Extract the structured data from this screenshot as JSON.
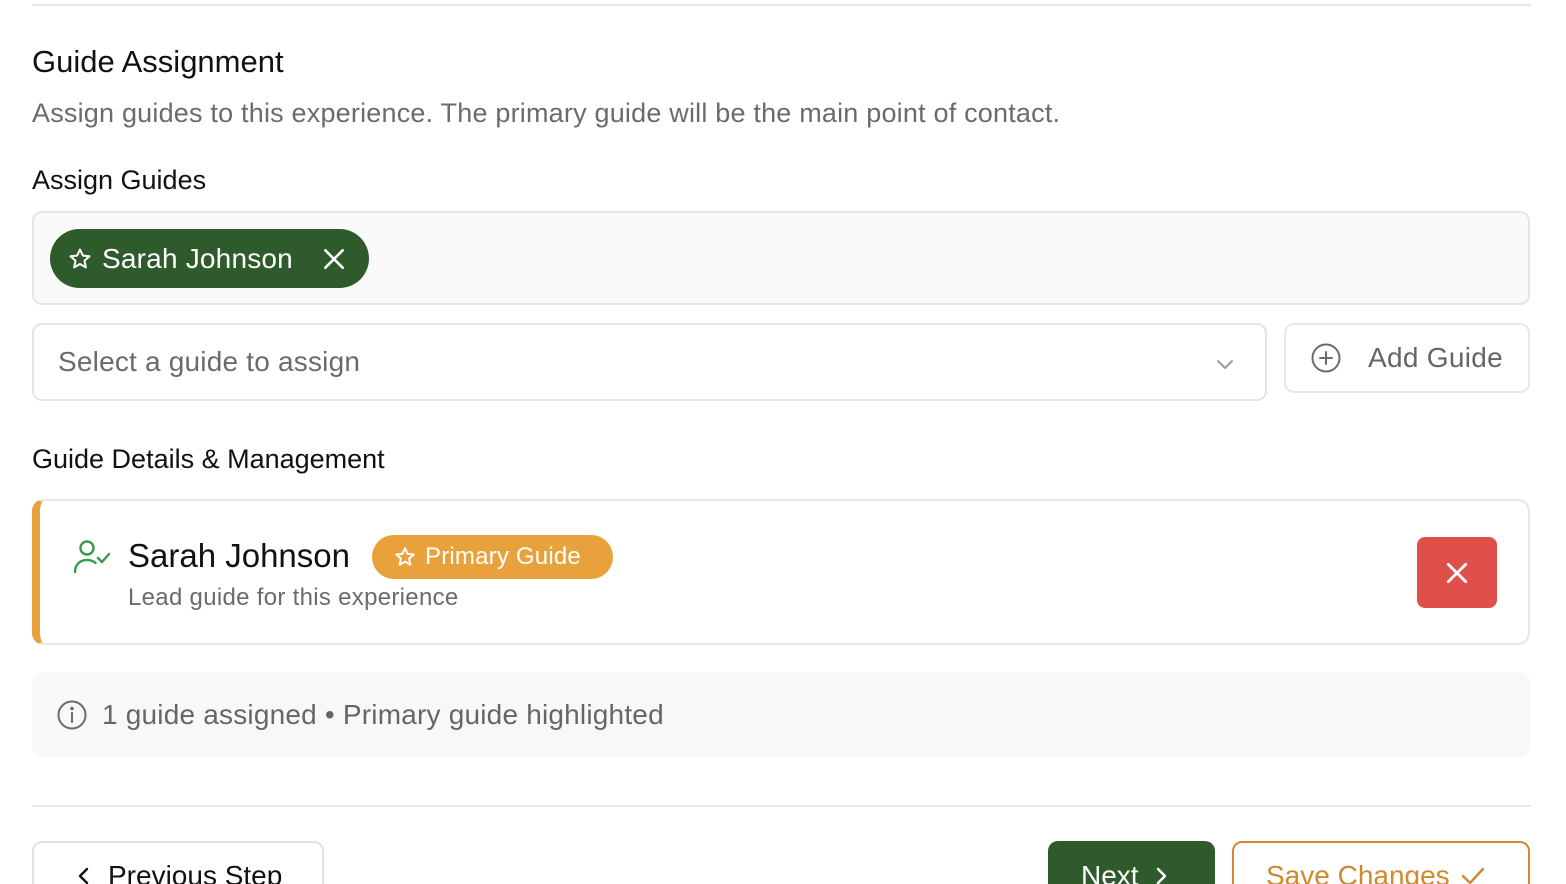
{
  "colors": {
    "primary_green": "#2f5a2c",
    "accent_orange": "#e9a23b",
    "danger_red": "#e0504b",
    "muted_text": "#6b6b6b"
  },
  "section": {
    "title": "Guide Assignment",
    "description": "Assign guides to this experience. The primary guide will be the main point of contact."
  },
  "assign": {
    "label": "Assign Guides",
    "chips": [
      {
        "name": "Sarah Johnson",
        "icon": "star-icon",
        "remove_icon": "close-icon"
      }
    ],
    "select_placeholder": "Select a guide to assign",
    "add_button": "Add Guide"
  },
  "details": {
    "label": "Guide Details & Management",
    "guides": [
      {
        "name": "Sarah Johnson",
        "badge": "Primary Guide",
        "subtitle": "Lead guide for this experience",
        "icon": "user-check-icon"
      }
    ]
  },
  "info": {
    "text": "1 guide assigned • Primary guide highlighted"
  },
  "footer": {
    "previous": "Previous Step",
    "next": "Next",
    "save": "Save Changes"
  }
}
